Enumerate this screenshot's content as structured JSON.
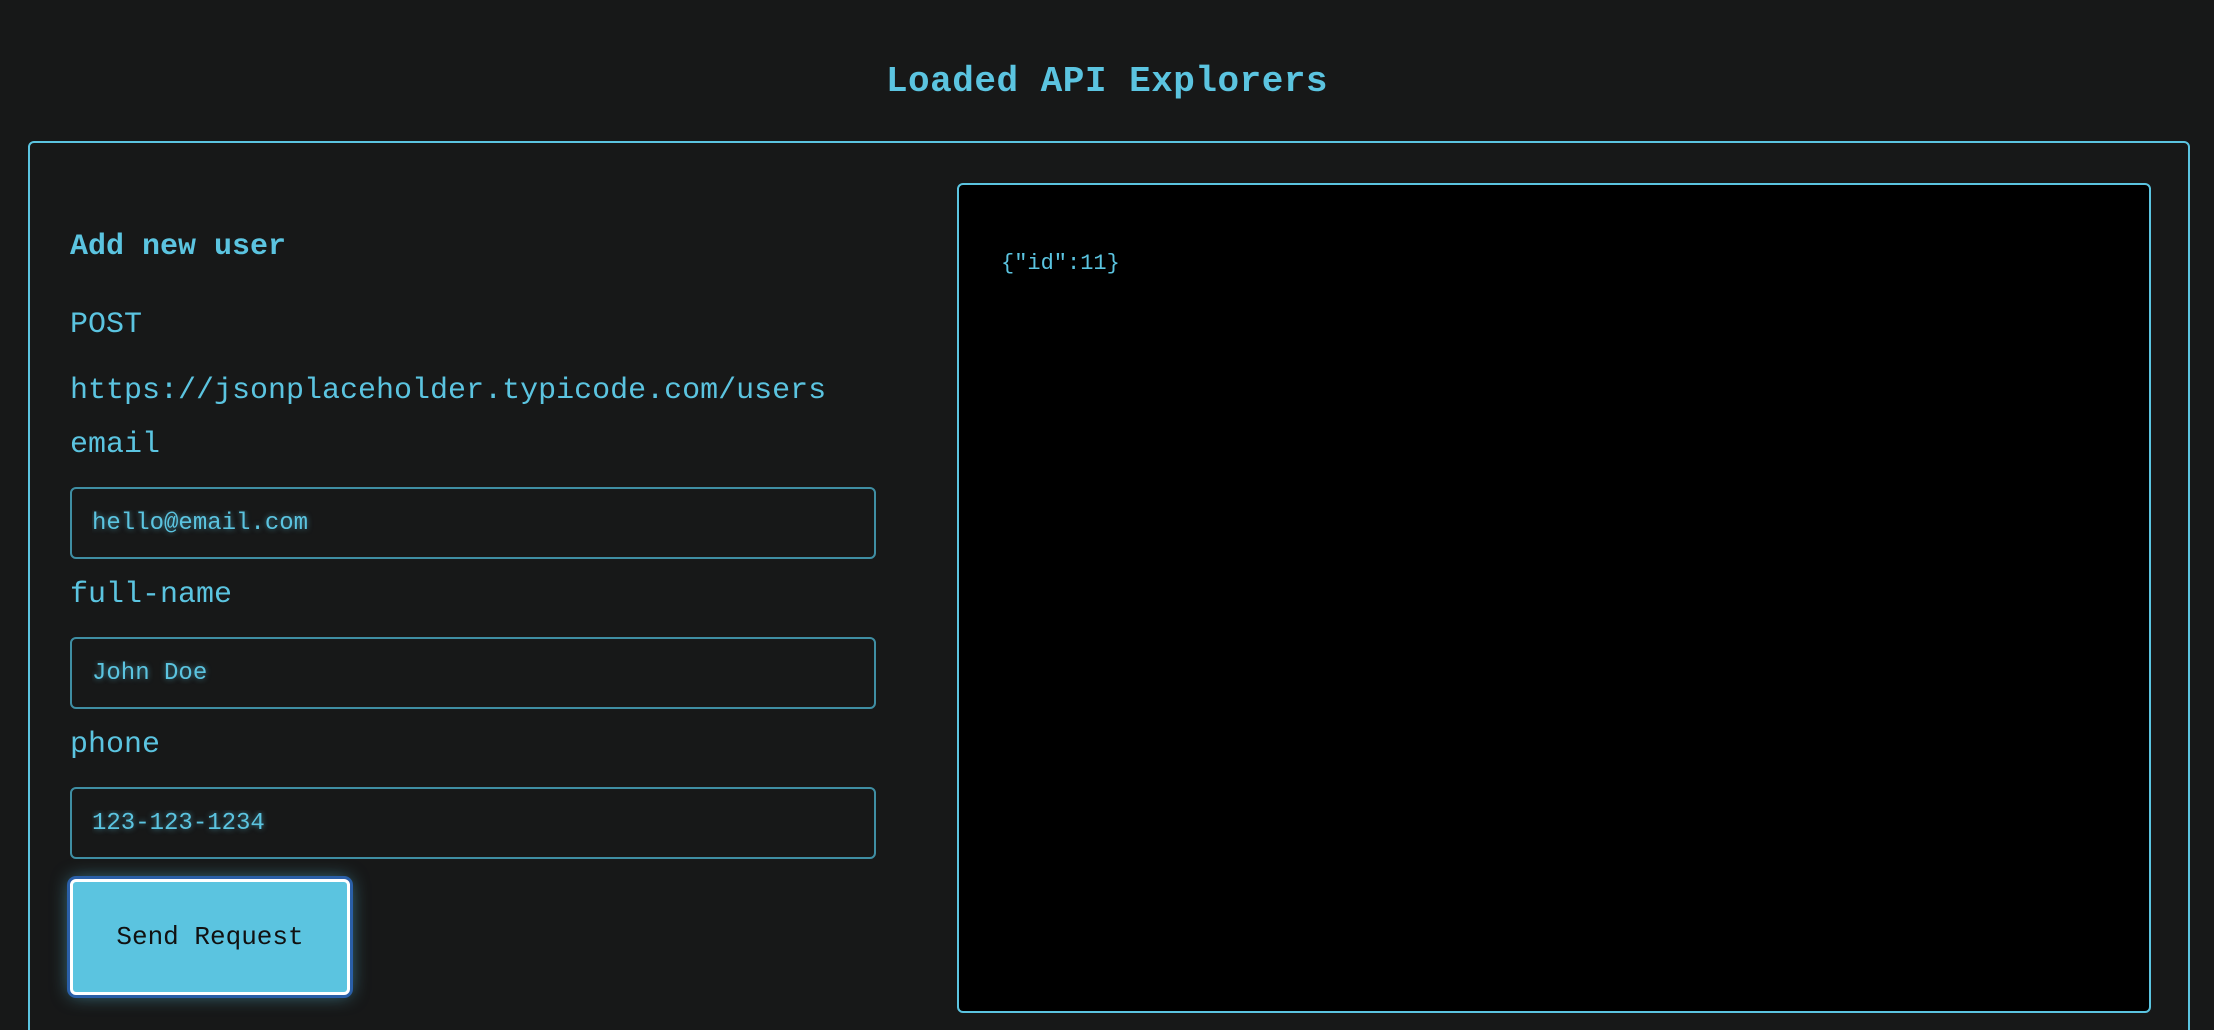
{
  "page": {
    "title": "Loaded API Explorers"
  },
  "explorer": {
    "heading": "Add new user",
    "method": "POST",
    "url": "https://jsonplaceholder.typicode.com/users",
    "fields": [
      {
        "label": "email",
        "placeholder": "hello@email.com",
        "value": ""
      },
      {
        "label": "full-name",
        "placeholder": "John Doe",
        "value": ""
      },
      {
        "label": "phone",
        "placeholder": "123-123-1234",
        "value": ""
      }
    ],
    "send_label": "Send Request",
    "response": "{\"id\":11}"
  },
  "theme": {
    "background": "#171818",
    "accent": "#5bc4e0",
    "button_border": "#ffffff",
    "button_focus_ring": "#2a5fa8",
    "response_background": "#000000"
  }
}
